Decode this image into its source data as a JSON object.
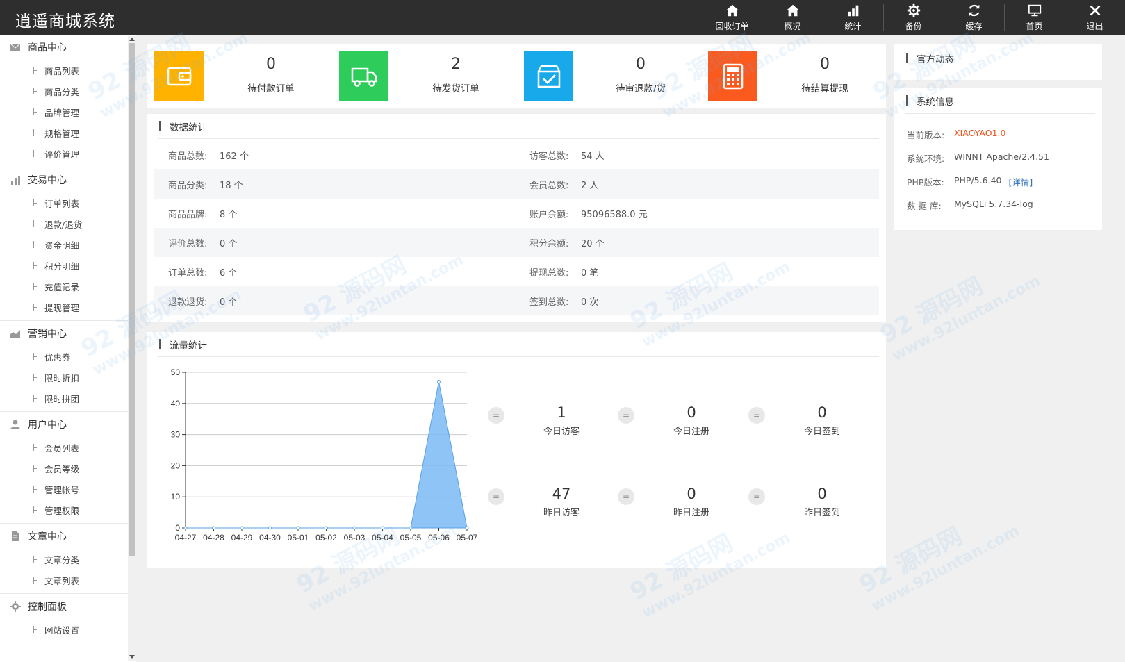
{
  "header": {
    "brand": "逍遥商城系统",
    "nav": [
      {
        "label": "回收订单",
        "icon": "home-icon"
      },
      {
        "label": "概况",
        "icon": "home-icon"
      },
      {
        "label": "统计",
        "icon": "bar-chart-icon"
      },
      {
        "label": "备份",
        "icon": "gear-icon"
      },
      {
        "label": "缓存",
        "icon": "refresh-icon"
      },
      {
        "label": "首页",
        "icon": "monitor-icon"
      },
      {
        "label": "退出",
        "icon": "close-icon"
      }
    ]
  },
  "sidebar": {
    "groups": [
      {
        "title": "商品中心",
        "icon": "mail-icon",
        "items": [
          "商品列表",
          "商品分类",
          "品牌管理",
          "规格管理",
          "评价管理"
        ]
      },
      {
        "title": "交易中心",
        "icon": "bar-chart-icon",
        "items": [
          "订单列表",
          "退款/退货",
          "资金明细",
          "积分明细",
          "充值记录",
          "提现管理"
        ]
      },
      {
        "title": "营销中心",
        "icon": "area-chart-icon",
        "items": [
          "优惠券",
          "限时折扣",
          "限时拼团"
        ]
      },
      {
        "title": "用户中心",
        "icon": "user-icon",
        "items": [
          "会员列表",
          "会员等级",
          "管理帐号",
          "管理权限"
        ]
      },
      {
        "title": "文章中心",
        "icon": "document-icon",
        "items": [
          "文章分类",
          "文章列表"
        ]
      },
      {
        "title": "控制面板",
        "icon": "gear-icon",
        "items": [
          "网站设置"
        ]
      }
    ]
  },
  "stats": [
    {
      "value": "0",
      "label": "待付款订单",
      "color": "#ffb300",
      "icon": "wallet-icon"
    },
    {
      "value": "2",
      "label": "待发货订单",
      "color": "#2ecc5b",
      "icon": "truck-icon"
    },
    {
      "value": "0",
      "label": "待审退款/货",
      "color": "#17a9ea",
      "icon": "box-check-icon"
    },
    {
      "value": "0",
      "label": "待结算提现",
      "color": "#fb5a1f",
      "icon": "calculator-icon"
    }
  ],
  "data_stats": {
    "title": "数据统计",
    "rows": [
      [
        {
          "label": "商品总数:",
          "value": "162 个"
        },
        {
          "label": "访客总数:",
          "value": "54 人"
        }
      ],
      [
        {
          "label": "商品分类:",
          "value": "18 个"
        },
        {
          "label": "会员总数:",
          "value": "2 人"
        }
      ],
      [
        {
          "label": "商品品牌:",
          "value": "8 个"
        },
        {
          "label": "账户余额:",
          "value": "95096588.0 元"
        }
      ],
      [
        {
          "label": "评价总数:",
          "value": "0 个"
        },
        {
          "label": "积分余额:",
          "value": "20 个"
        }
      ],
      [
        {
          "label": "订单总数:",
          "value": "6 个"
        },
        {
          "label": "提现总数:",
          "value": "0 笔"
        }
      ],
      [
        {
          "label": "退款退货:",
          "value": "0 个"
        },
        {
          "label": "签到总数:",
          "value": "0 次"
        }
      ]
    ]
  },
  "traffic": {
    "title": "流量统计",
    "metrics": [
      {
        "value": "1",
        "label": "今日访客"
      },
      {
        "value": "0",
        "label": "今日注册"
      },
      {
        "value": "0",
        "label": "今日签到"
      },
      {
        "value": "47",
        "label": "昨日访客"
      },
      {
        "value": "0",
        "label": "昨日注册"
      },
      {
        "value": "0",
        "label": "昨日签到"
      }
    ],
    "eq_symbol": "="
  },
  "chart_data": {
    "type": "area",
    "categories": [
      "04-27",
      "04-28",
      "04-29",
      "04-30",
      "05-01",
      "05-02",
      "05-03",
      "05-04",
      "05-05",
      "05-06",
      "05-07"
    ],
    "values": [
      0,
      0,
      0,
      0,
      0,
      0,
      0,
      0,
      0,
      47,
      0
    ],
    "ylim": [
      0,
      50
    ],
    "yticks": [
      0,
      10,
      20,
      30,
      40,
      50
    ],
    "color": "#7bbaf5",
    "grid": true
  },
  "news": {
    "title": "官方动态"
  },
  "sysinfo": {
    "title": "系统信息",
    "rows": [
      {
        "label": "当前版本:",
        "value": "XIAOYAO1.0",
        "accent": "#e8531c"
      },
      {
        "label": "系统环境:",
        "value": "WINNT Apache/2.4.51"
      },
      {
        "label": "PHP版本:",
        "value": "PHP/5.6.40",
        "link": "[详情]"
      },
      {
        "label": "数 据 库:",
        "value": "MySQLi 5.7.34-log"
      }
    ]
  },
  "watermark": {
    "line1": "92 源码网",
    "line2": "www.92luntan.com"
  }
}
